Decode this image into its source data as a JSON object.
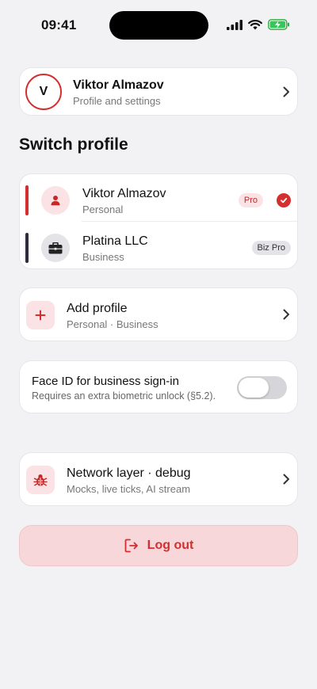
{
  "status": {
    "time": "09:41"
  },
  "account": {
    "avatar_initial": "V",
    "name": "Viktor Almazov",
    "subtitle": "Profile and settings"
  },
  "switch_title": "Switch profile",
  "profiles": [
    {
      "name": "Viktor Almazov",
      "type": "Personal",
      "badge": "Pro",
      "selected": true,
      "accent": "#d32f2f"
    },
    {
      "name": "Platina LLC",
      "type": "Business",
      "badge": "Biz Pro",
      "selected": false,
      "accent": "#2c2c3a"
    }
  ],
  "add_profile": {
    "title": "Add profile",
    "subtitle": "Personal · Business"
  },
  "face_id": {
    "title": "Face ID for business sign-in",
    "subtitle": "Requires an extra biometric unlock (§5.2).",
    "enabled": false
  },
  "network": {
    "title": "Network layer · debug",
    "subtitle": "Mocks, live ticks, AI stream"
  },
  "logout": {
    "label": "Log out"
  },
  "colors": {
    "accent": "#d32f2f",
    "background": "#f2f2f5",
    "badge_pink": "#fbe3e5",
    "logout_bg": "#f8d7da"
  },
  "icons": [
    "signal-icon",
    "wifi-icon",
    "battery-charging-icon",
    "chevron-right-icon",
    "person-icon",
    "briefcase-icon",
    "check-icon",
    "plus-icon",
    "bug-icon",
    "logout-icon"
  ]
}
